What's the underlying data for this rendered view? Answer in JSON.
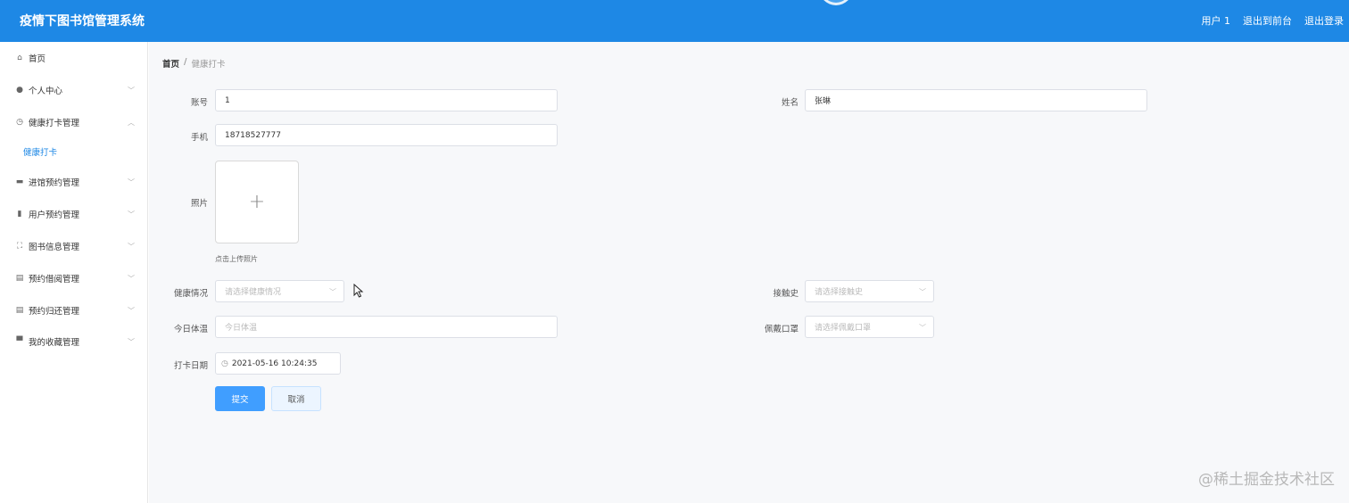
{
  "header": {
    "title": "疫情下图书馆管理系统",
    "links": [
      "用户 1",
      "退出到前台",
      "退出登录"
    ]
  },
  "sidebar": {
    "items": [
      {
        "label": "首页",
        "icon": "home-icon",
        "glyph": "⌂"
      },
      {
        "label": "个人中心",
        "icon": "user-icon",
        "glyph": "●"
      },
      {
        "label": "健康打卡管理",
        "icon": "clock-icon",
        "glyph": "◷"
      },
      {
        "label": "健康打卡",
        "icon": "",
        "glyph": ""
      },
      {
        "label": "进馆预约管理",
        "icon": "briefcase-icon",
        "glyph": "▬"
      },
      {
        "label": "用户预约管理",
        "icon": "bar-chart-icon",
        "glyph": "▮"
      },
      {
        "label": "图书信息管理",
        "icon": "frame-icon",
        "glyph": "⛶"
      },
      {
        "label": "预约借阅管理",
        "icon": "clipboard-icon",
        "glyph": "▤"
      },
      {
        "label": "预约归还管理",
        "icon": "clipboard-icon",
        "glyph": "▤"
      },
      {
        "label": "我的收藏管理",
        "icon": "monitor-icon",
        "glyph": "▀"
      }
    ]
  },
  "breadcrumb": {
    "home": "首页",
    "separator": "/",
    "current": "健康打卡"
  },
  "form": {
    "account": {
      "label": "账号",
      "value": "1"
    },
    "name": {
      "label": "姓名",
      "value": "张琳"
    },
    "phone": {
      "label": "手机",
      "value": "18718527777"
    },
    "photo": {
      "label": "照片",
      "hint": "点击上传照片"
    },
    "health": {
      "label": "健康情况",
      "placeholder": "请选择健康情况"
    },
    "contact": {
      "label": "接触史",
      "placeholder": "请选择接触史"
    },
    "temperature": {
      "label": "今日体温",
      "placeholder": "今日体温"
    },
    "mask": {
      "label": "佩戴口罩",
      "placeholder": "请选择佩戴口罩"
    },
    "date": {
      "label": "打卡日期",
      "value": "2021-05-16 10:24:35"
    },
    "submit": "提交",
    "cancel": "取消"
  },
  "watermark": "@稀土掘金技术社区",
  "colors": {
    "header": "#1e88e5",
    "primary": "#409eff",
    "sidebar_active": "#1e88e5"
  }
}
